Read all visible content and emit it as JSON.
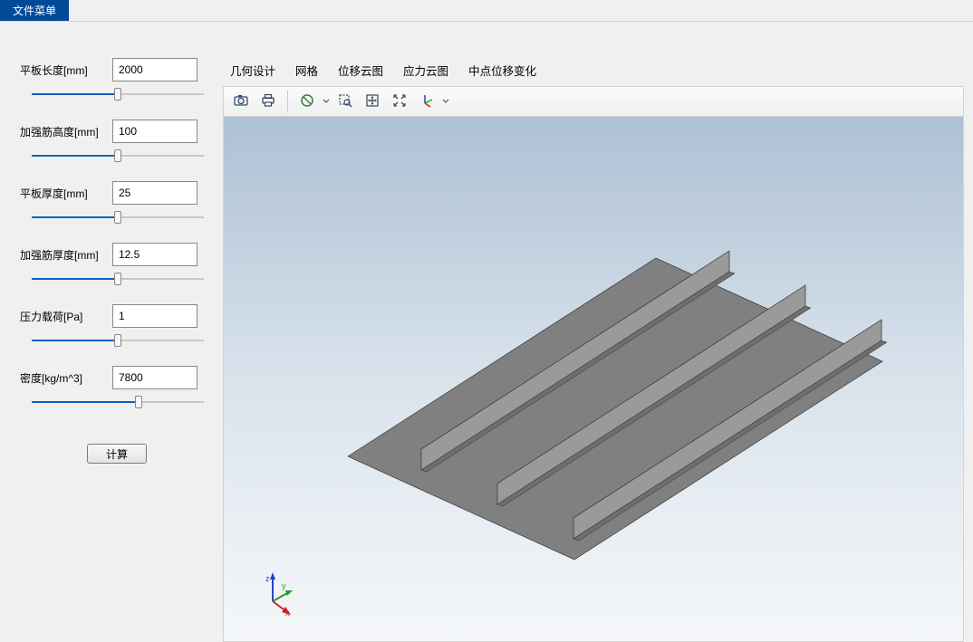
{
  "menubar": {
    "file_menu": "文件菜单"
  },
  "params": [
    {
      "label": "平板长度[mm]",
      "value": "2000",
      "fill": 50
    },
    {
      "label": "加强筋高度[mm]",
      "value": "100",
      "fill": 50
    },
    {
      "label": "平板厚度[mm]",
      "value": "25",
      "fill": 50
    },
    {
      "label": "加强筋厚度[mm]",
      "value": "12.5",
      "fill": 50
    },
    {
      "label": "压力载荷[Pa]",
      "value": "1",
      "fill": 50
    },
    {
      "label": "密度[kg/m^3]",
      "value": "7800",
      "fill": 62
    }
  ],
  "compute_button": "计算",
  "tabs": [
    {
      "label": "几何设计"
    },
    {
      "label": "网格"
    },
    {
      "label": "位移云图"
    },
    {
      "label": "应力云图"
    },
    {
      "label": "中点位移变化"
    }
  ],
  "toolbar": {
    "icons": [
      "camera-icon",
      "print-icon",
      "SEP",
      "reset-view-icon",
      "DROP",
      "zoom-box-icon",
      "fit-view-icon",
      "zoom-extents-icon",
      "axes-icon",
      "DROP"
    ]
  },
  "axes": {
    "x": "x",
    "y": "y",
    "z": "z"
  },
  "colors": {
    "menubar_bg": "#004b98",
    "slider_fill": "#0b61c4",
    "plate": "#9a9a9a",
    "axis_x": "#cc2222",
    "axis_y": "#2a9a2a",
    "axis_z": "#2244cc"
  }
}
